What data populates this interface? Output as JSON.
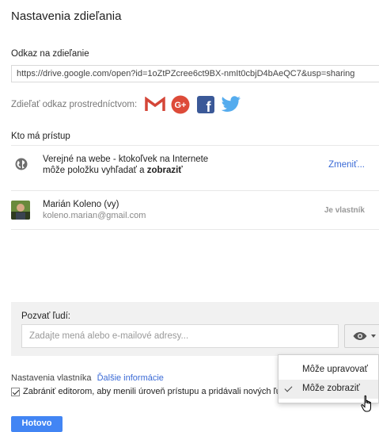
{
  "dialog": {
    "title": "Nastavenia zdieľania"
  },
  "link": {
    "label": "Odkaz na zdieľanie",
    "url": "https://drive.google.com/open?id=1oZtPZcree6ct9BX-nmIt0cbjD4bAeQC7&usp=sharing"
  },
  "share_via": {
    "label": "Zdieľať odkaz prostredníctvom:",
    "icons": [
      "gmail-icon",
      "google-plus-icon",
      "facebook-icon",
      "twitter-icon"
    ],
    "gplus_text": "G+",
    "fb_text": "f"
  },
  "access": {
    "label": "Kto má prístup",
    "public": {
      "line1": "Verejné na webe - ktokoľvek na Internete",
      "line2_prefix": "môže položku vyhľadať a ",
      "line2_bold": "zobraziť",
      "action": "Zmeniť..."
    },
    "owner": {
      "name": "Marián Koleno (vy)",
      "email": "koleno.marian@gmail.com",
      "role": "Je vlastník"
    }
  },
  "invite": {
    "label": "Pozvať ľudí:",
    "placeholder": "Zadajte mená alebo e-mailové adresy..."
  },
  "owner_settings": {
    "label": "Nastavenia vlastníka",
    "link": "Ďalšie informácie"
  },
  "prevent_editors": {
    "checked": true,
    "label": "Zabrániť editorom, aby menili úroveň prístupu a pridávali nových ľudí"
  },
  "done_button": "Hotovo",
  "permission_menu": {
    "items": [
      {
        "label": "Môže upravovať",
        "selected": false
      },
      {
        "label": "Môže zobraziť",
        "selected": true
      }
    ]
  },
  "colors": {
    "accent_blue": "#4285f4",
    "link_blue": "#3a6ad6",
    "gmail_red": "#d44638",
    "gplus_red": "#dd4b39",
    "facebook_blue": "#3b5998",
    "twitter_blue": "#55acee"
  }
}
